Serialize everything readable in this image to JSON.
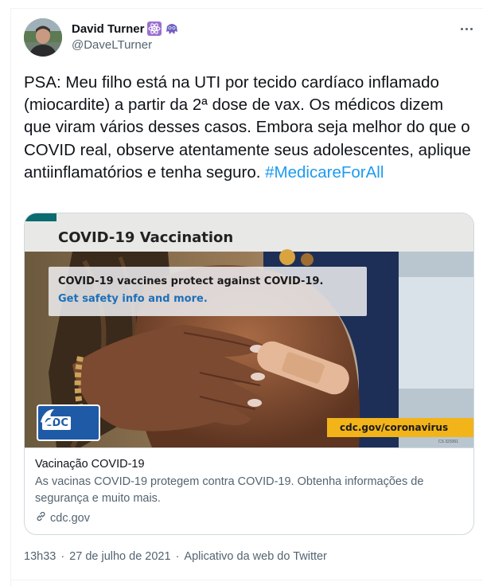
{
  "user": {
    "display_name": "David Turner",
    "handle": "@DaveLTurner",
    "badges": [
      "atom-emoji",
      "alien-monster-emoji"
    ]
  },
  "menu": {
    "icon": "more-horizontal-icon"
  },
  "tweet": {
    "text": "PSA: Meu filho está na UTI por tecido cardíaco inflamado (miocardite) a partir da 2ª dose de vax. Os médicos dizem que viram vários desses casos. Embora seja melhor do que o COVID real, observe atentamente seus adolescentes, aplique antiinflamatórios e tenha seguro. ",
    "hashtag": "#MedicareForAll"
  },
  "card": {
    "image": {
      "title": "COVID-19 Vaccination",
      "overlay_line1": "COVID-19 vaccines protect against COVID-19.",
      "overlay_line2": "Get safety info and more.",
      "logo_text": "CDC",
      "banner_url": "cdc.gov/coronavirus",
      "code": "CS 323361"
    },
    "title": "Vacinação COVID-19",
    "description": "As vacinas COVID-19 protegem contra COVID-19. Obtenha informações de segurança e muito mais.",
    "domain": "cdc.gov",
    "domain_icon": "link-icon"
  },
  "meta": {
    "time": "13h33",
    "date": "27 de julho de 2021",
    "separator": "·",
    "source": "Aplicativo da web do Twitter"
  },
  "colors": {
    "accent": "#1d9bf0",
    "secondary_text": "#536471",
    "border": "#cfd9de",
    "cdc_blue": "#1f5aa6",
    "banner_yellow": "#f2b418"
  }
}
